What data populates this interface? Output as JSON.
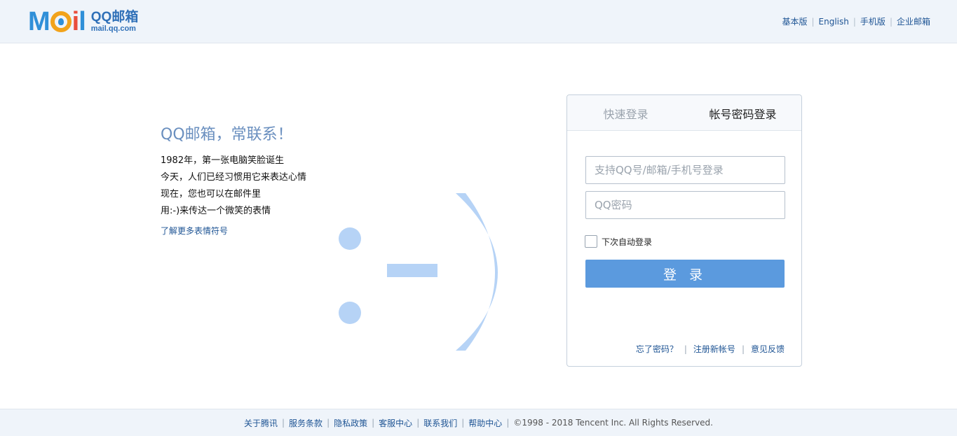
{
  "header": {
    "logo_word": "Mail",
    "logo_title": "QQ邮箱",
    "logo_domain": "mail.qq.com",
    "links": [
      "基本版",
      "English",
      "手机版",
      "企业邮箱"
    ]
  },
  "intro": {
    "title": "QQ邮箱，常联系！",
    "lines": [
      "1982年，第一张电脑笑脸诞生",
      "今天，人们已经习惯用它来表达心情",
      "现在，您也可以在邮件里",
      "用:-)来传达一个微笑的表情"
    ],
    "more_link": "了解更多表情符号",
    "smiley_color": "#b6d3f6"
  },
  "login": {
    "tabs": [
      "快速登录",
      "帐号密码登录"
    ],
    "active_tab": 1,
    "username_placeholder": "支持QQ号/邮箱/手机号登录",
    "password_placeholder": "QQ密码",
    "remember_label": "下次自动登录",
    "remember_checked": false,
    "submit_label": "登 录",
    "links": [
      "忘了密码？",
      "注册新帐号",
      "意见反馈"
    ],
    "accent": "#5b9ade"
  },
  "footer": {
    "links": [
      "关于腾讯",
      "服务条款",
      "隐私政策",
      "客服中心",
      "联系我们",
      "帮助中心"
    ],
    "copyright": "©1998 - 2018 Tencent Inc. All Rights Reserved."
  }
}
